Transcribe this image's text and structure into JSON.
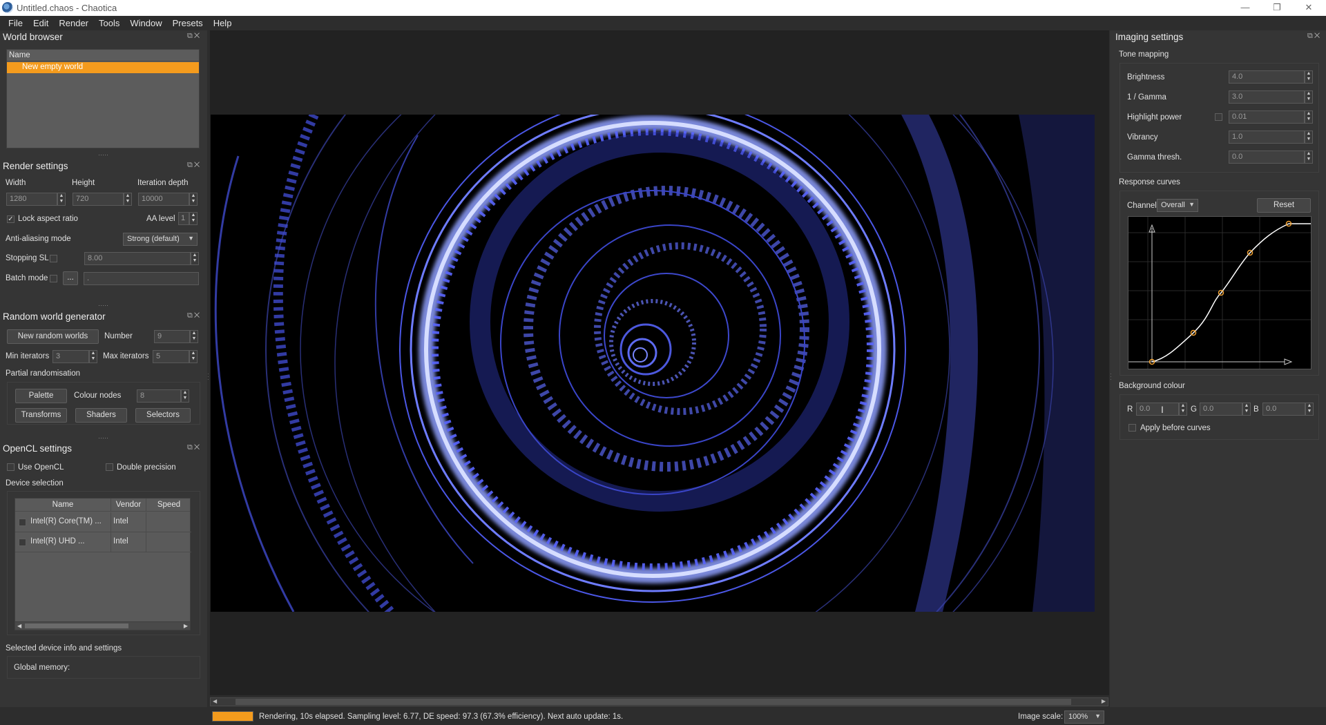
{
  "window": {
    "title": "Untitled.chaos - Chaotica",
    "minimize": "—",
    "restore": "❐",
    "close": "✕"
  },
  "menu": [
    "File",
    "Edit",
    "Render",
    "Tools",
    "Window",
    "Presets",
    "Help"
  ],
  "world_browser": {
    "title": "World browser",
    "column_name": "Name",
    "items": [
      "New empty world"
    ]
  },
  "render_settings": {
    "title": "Render settings",
    "width_label": "Width",
    "height_label": "Height",
    "depth_label": "Iteration depth",
    "width": "1280",
    "height": "720",
    "depth": "10000",
    "lock_aspect_label": "Lock aspect ratio",
    "lock_aspect_checked": true,
    "aa_level_label": "AA level",
    "aa_level": "1",
    "aa_mode_label": "Anti-aliasing mode",
    "aa_mode": "Strong (default)",
    "stopping_label": "Stopping SL",
    "stopping_value": "8.00",
    "batch_label": "Batch mode",
    "batch_button": "...",
    "batch_value": "."
  },
  "random_gen": {
    "title": "Random world generator",
    "new_button": "New random worlds",
    "number_label": "Number",
    "number": "9",
    "min_label": "Min iterators",
    "min": "3",
    "max_label": "Max iterators",
    "max": "5",
    "partial_label": "Partial randomisation",
    "palette_button": "Palette",
    "colour_nodes_label": "Colour nodes",
    "colour_nodes": "8",
    "transforms_button": "Transforms",
    "shaders_button": "Shaders",
    "selectors_button": "Selectors"
  },
  "opencl": {
    "title": "OpenCL settings",
    "use_label": "Use OpenCL",
    "double_label": "Double precision",
    "device_selection_label": "Device selection",
    "columns": [
      "Name",
      "Vendor",
      "Speed"
    ],
    "devices": [
      {
        "name": "Intel(R) Core(TM) ...",
        "vendor": "Intel",
        "speed": ""
      },
      {
        "name": "Intel(R) UHD ...",
        "vendor": "Intel",
        "speed": ""
      }
    ],
    "info_label": "Selected device info and settings",
    "global_memory_label": "Global memory:"
  },
  "imaging": {
    "title": "Imaging settings",
    "tone_mapping_label": "Tone mapping",
    "brightness_label": "Brightness",
    "brightness": "4.0",
    "gamma_label": "1 / Gamma",
    "gamma": "3.0",
    "highlight_label": "Highlight power",
    "highlight": "0.01",
    "vibrancy_label": "Vibrancy",
    "vibrancy": "1.0",
    "gamma_thresh_label": "Gamma thresh.",
    "gamma_thresh": "0.0",
    "response_curves_label": "Response curves",
    "channel_label": "Channel:",
    "channel": "Overall",
    "reset_button": "Reset",
    "background_colour_label": "Background colour",
    "r_label": "R",
    "r": "0.0",
    "g_label": "G",
    "g": "0.0",
    "b_label": "B",
    "b": "0.0",
    "apply_before_label": "Apply before curves"
  },
  "status": {
    "progress": 1.0,
    "message": "Rendering, 10s elapsed. Sampling level: 6.77, DE speed: 97.3 (67.3% efficiency). Next auto update: 1s.",
    "scale_label": "Image scale:",
    "scale": "100%"
  },
  "colors": {
    "accent": "#f49b1d",
    "fractal_glow": "#7f8cff",
    "fractal_dark": "#2a2f8c"
  },
  "icons": {
    "dock_float": "float-icon",
    "dock_close": "close-icon",
    "spin": "spin-arrows-icon",
    "dropdown": "chevron-down-icon"
  }
}
